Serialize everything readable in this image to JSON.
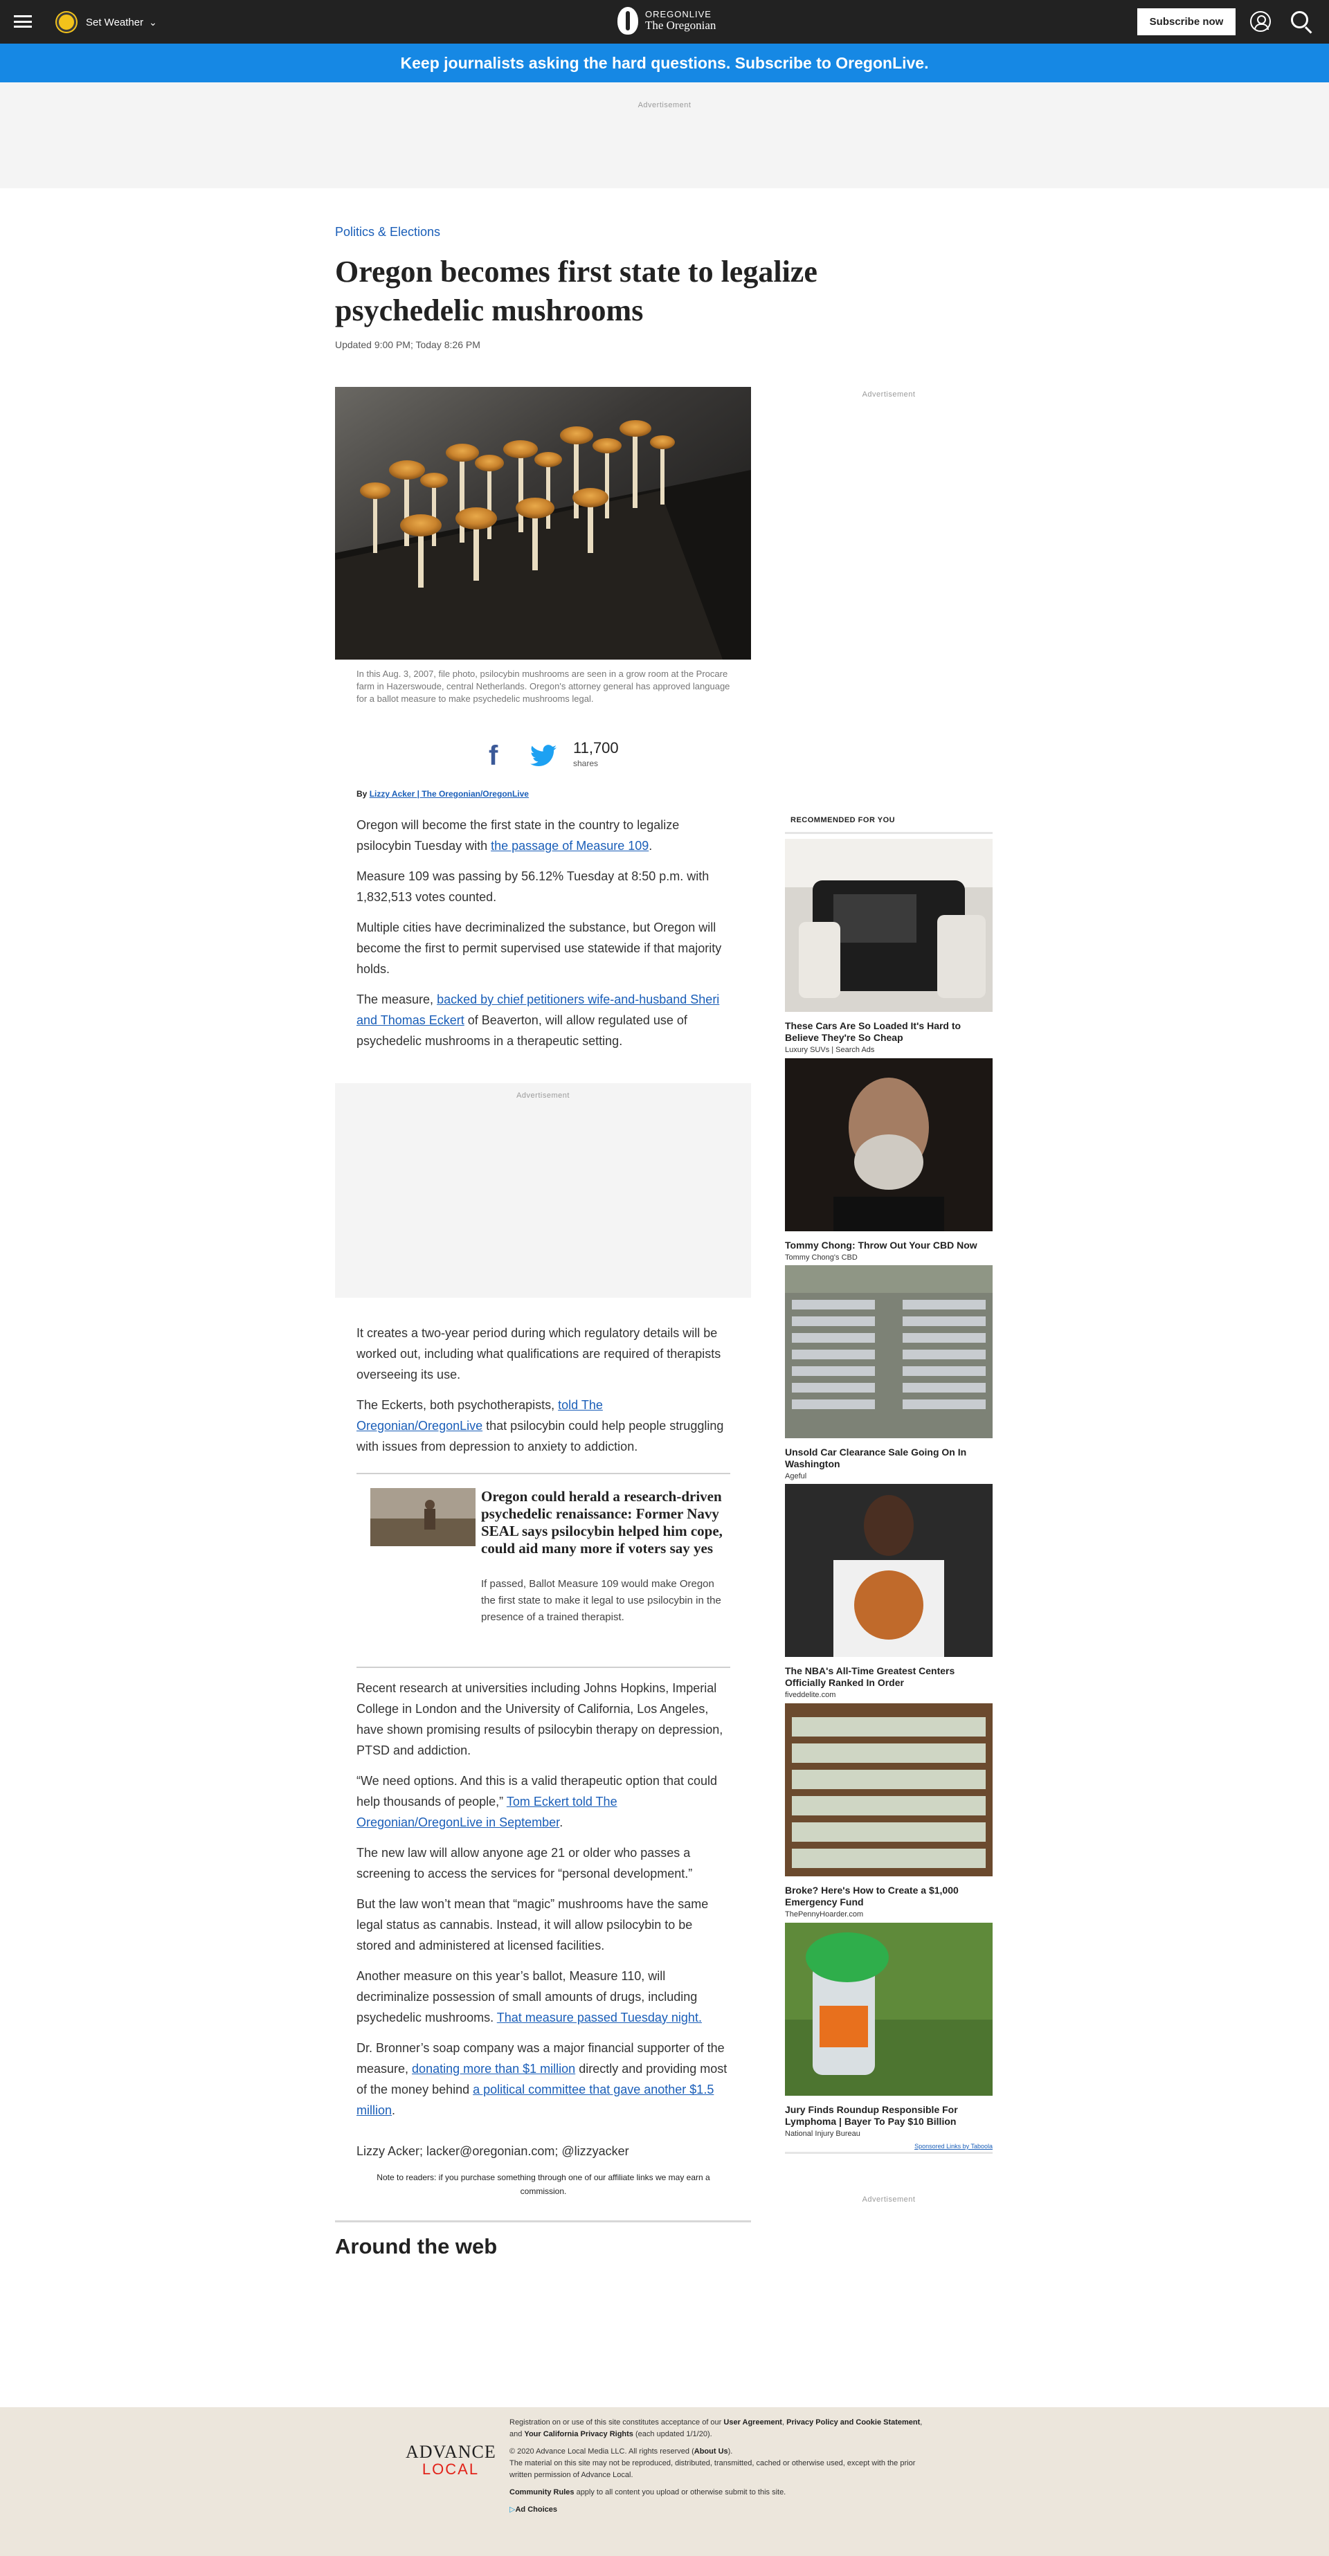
{
  "header": {
    "weather_label": "Set Weather",
    "logo_top": "OREGONLIVE",
    "logo_bottom": "The Oregonian",
    "subscribe_label": "Subscribe now"
  },
  "promo_banner": "Keep journalists asking the hard questions. Subscribe to OregonLive.",
  "ad_label": "Advertisement",
  "article": {
    "category": "Politics & Elections",
    "title": "Oregon becomes first state to legalize psychedelic mushrooms",
    "updated": "Updated 9:00 PM; Today 8:26 PM",
    "caption": "In this Aug. 3, 2007, file photo, psilocybin mushrooms are seen in a grow room at the Procare farm in Hazerswoude, central Netherlands. Oregon's attorney general has approved language for a ballot measure to make psychedelic mushrooms legal.",
    "share_count": "11,700",
    "share_label": "shares",
    "byline_prefix": "By",
    "byline_author": "Lizzy Acker | The Oregonian/OregonLive",
    "p1_text": "Oregon will become the first state in the country to legalize psilocybin Tuesday with ",
    "p1_link": "the passage of Measure 109",
    "p1_end": ".",
    "p2": "Measure 109 was passing by 56.12% Tuesday at 8:50 p.m. with 1,832,513 votes counted.",
    "p3": "Multiple cities have decriminalized the substance, but Oregon will become the first to permit supervised use statewide if that majority holds.",
    "p4_start": "The measure, ",
    "p4_link": "backed by chief petitioners wife-and-husband Sheri and Thomas Eckert",
    "p4_end": " of Beaverton, will allow regulated use of psychedelic mushrooms in a therapeutic setting.",
    "p5": "It creates a two-year period during which regulatory details will be worked out, including what qualifications are required of therapists overseeing its use.",
    "p6_start": "The Eckerts, both psychotherapists, ",
    "p6_link": "told The Oregonian/OregonLive",
    "p6_end": " that psilocybin could help people struggling with issues from depression to anxiety to addiction.",
    "related_title": "Oregon could herald a research-driven psychedelic renaissance: Former Navy SEAL says psilocybin helped him cope, could aid many more if voters say yes",
    "related_desc": "If passed, Ballot Measure 109 would make Oregon the first state to make it legal to use psilocybin in the presence of a trained therapist.",
    "p7": "Recent research at universities including Johns Hopkins, Imperial College in London and the University of California, Los Angeles, have shown promising results of psilocybin therapy on depression, PTSD and addiction.",
    "p8_start": "“We need options. And this is a valid therapeutic option that could help thousands of people,” ",
    "p8_link": "Tom Eckert told The Oregonian/OregonLive in September",
    "p8_end": ".",
    "p9": "The new law will allow anyone age 21 or older who passes a screening to access the services for “personal development.”",
    "p10": "But the law won’t mean that “magic” mushrooms have the same legal status as cannabis. Instead, it will allow psilocybin to be stored and administered at licensed facilities.",
    "p11_start": "Another measure on this year’s ballot, Measure 110, will decriminalize possession of small amounts of drugs, including psychedelic mushrooms. ",
    "p11_link": "That measure passed Tuesday night.",
    "p12_start": "Dr. Bronner’s soap company was a major financial supporter of the measure, ",
    "p12_link1": "donating more than $1 million",
    "p12_mid": " directly and providing most of the money behind ",
    "p12_link2": "a political committee that gave another $1.5 million",
    "p12_end": ".",
    "contact": "Lizzy Acker; lacker@oregonian.com; @lizzyacker",
    "note": "Note to readers: if you purchase something through one of our affiliate links we may earn a commission.",
    "around_web": "Around the web"
  },
  "sidebar": {
    "recommended_heading": "RECOMMENDED FOR YOU",
    "items": [
      {
        "title": "These Cars Are So Loaded It's Hard to Believe They're So Cheap",
        "source": "Luxury SUVs | Search Ads"
      },
      {
        "title": "Tommy Chong: Throw Out Your CBD Now",
        "source": "Tommy Chong's CBD"
      },
      {
        "title": "Unsold Car Clearance Sale Going On In Washington",
        "source": "Ageful"
      },
      {
        "title": "The NBA's All-Time Greatest Centers Officially Ranked In Order",
        "source": "fiveddelite.com"
      },
      {
        "title": "Broke? Here's How to Create a $1,000 Emergency Fund",
        "source": "ThePennyHoarder.com"
      },
      {
        "title": "Jury Finds Roundup Responsible For Lymphoma | Bayer To Pay $10 Billion",
        "source": "National Injury Bureau"
      }
    ],
    "taboola": "Sponsored Links by Taboola"
  },
  "footer": {
    "logo_top": "ADVANCE",
    "logo_bottom": "LOCAL",
    "line1_a": "Registration on or use of this site constitutes acceptance of our ",
    "line1_b": "User Agreement",
    "line1_c": ", ",
    "line1_d": "Privacy Policy and Cookie Statement",
    "line1_e": ", and ",
    "line1_f": "Your California Privacy Rights",
    "line1_g": " (each updated 1/1/20).",
    "line2_a": "© 2020 Advance Local Media LLC. All rights reserved (",
    "line2_b": "About Us",
    "line2_c": ").",
    "line3": "The material on this site may not be reproduced, distributed, transmitted, cached or otherwise used, except with the prior written permission of Advance Local.",
    "line4_a": "Community Rules",
    "line4_b": " apply to all content you upload or otherwise submit to this site.",
    "ad_choices": "Ad Choices"
  }
}
